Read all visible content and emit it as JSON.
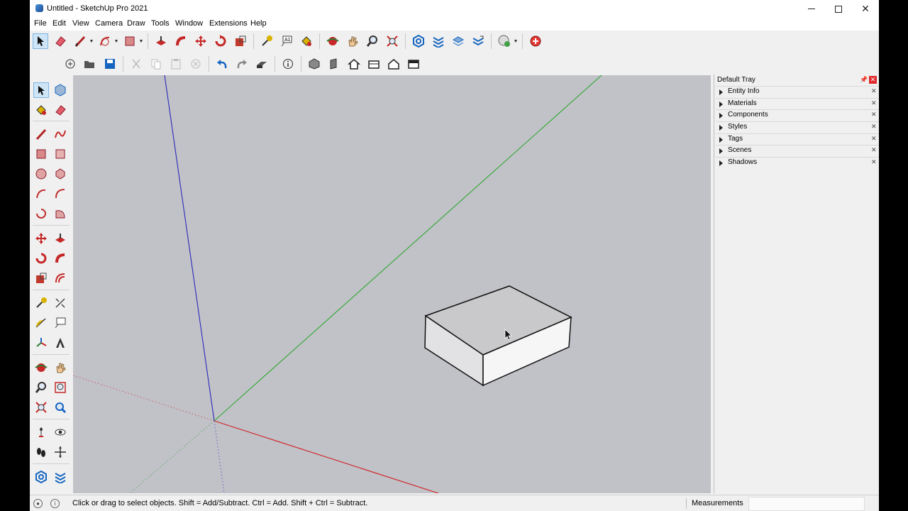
{
  "window": {
    "title": "Untitled - SketchUp Pro 2021",
    "minimize_icon": "minimize-icon",
    "maximize_icon": "maximize-icon",
    "close_icon": "close-icon"
  },
  "menu": [
    "File",
    "Edit",
    "View",
    "Camera",
    "Draw",
    "Tools",
    "Window",
    "Extensions",
    "Help"
  ],
  "toolbar_top_icons": [
    "select-icon",
    "eraser-icon",
    "line-icon",
    "arc-icon",
    "rectangle-icon",
    "push-pull-icon",
    "follow-me-icon",
    "move-icon",
    "rotate-icon",
    "scale-icon",
    "tape-measure-icon",
    "text-icon",
    "paint-bucket-icon",
    "orbit-icon",
    "pan-icon",
    "zoom-icon",
    "zoom-extents-icon",
    "warehouse-icon",
    "extension-warehouse-icon",
    "layout-icon",
    "styles-icon",
    "geo-location-icon",
    "ruby-console-icon"
  ],
  "toolbar_second_icons": [
    "new-icon",
    "open-icon",
    "save-icon",
    "cut-icon",
    "copy-icon",
    "paste-icon",
    "delete-icon",
    "undo-icon",
    "redo-icon",
    "print-icon",
    "model-info-icon",
    "iso-view-icon",
    "top-view-icon",
    "front-view-icon",
    "right-view-icon",
    "back-view-icon",
    "left-view-icon"
  ],
  "tray": {
    "title": "Default Tray",
    "pin_icon": "pin-icon",
    "close_label": "✕",
    "panels": [
      {
        "label": "Entity Info"
      },
      {
        "label": "Materials"
      },
      {
        "label": "Components"
      },
      {
        "label": "Styles"
      },
      {
        "label": "Tags"
      },
      {
        "label": "Scenes"
      },
      {
        "label": "Shadows"
      }
    ]
  },
  "status": {
    "hint": "Click or drag to select objects. Shift = Add/Subtract. Ctrl = Add. Shift + Ctrl = Subtract.",
    "measurements_label": "Measurements",
    "measurements_value": ""
  },
  "colors": {
    "viewport_bg": "#c1c1c8",
    "axis_red": "#d02020",
    "axis_green": "#2faa2f",
    "axis_blue": "#2a2ab8",
    "accent_select": "#cde5f7",
    "box_top": "#c9c9cb",
    "box_left": "#e2e2e4",
    "box_right": "#f6f6f7"
  }
}
